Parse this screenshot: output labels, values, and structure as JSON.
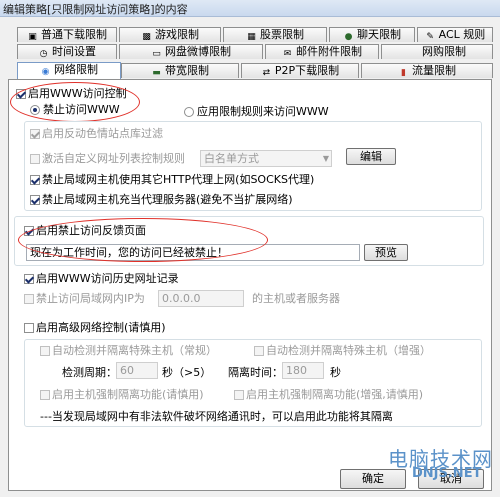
{
  "window": {
    "title": "编辑策略[只限制网址访问策略]的内容"
  },
  "tabs": {
    "row1": [
      {
        "label": "普通下载限制",
        "icon": "download-icon"
      },
      {
        "label": "游戏限制",
        "icon": "game-icon"
      },
      {
        "label": "股票限制",
        "icon": "stock-icon"
      },
      {
        "label": "聊天限制",
        "icon": "chat-icon"
      },
      {
        "label": "ACL 规则",
        "icon": "acl-icon"
      }
    ],
    "row2": [
      {
        "label": "时间设置",
        "icon": "clock-icon"
      },
      {
        "label": "网盘微博限制",
        "icon": "cloud-icon"
      },
      {
        "label": "邮件附件限制",
        "icon": "mail-icon"
      },
      {
        "label": "网购限制",
        "icon": "shop-icon"
      }
    ],
    "row3": [
      {
        "label": "网络限制",
        "icon": "network-icon"
      },
      {
        "label": "带宽限制",
        "icon": "bandwidth-icon"
      },
      {
        "label": "P2P下载限制",
        "icon": "p2p-icon"
      },
      {
        "label": "流量限制",
        "icon": "traffic-icon"
      }
    ]
  },
  "www": {
    "enable_label": "启用WWW访问控制",
    "enable_checked": true,
    "radio_block": "禁止访问WWW",
    "radio_rules": "应用限制规则来访问WWW",
    "porn_filter": "启用反动色情站点库过滤",
    "custom_list": "激活自定义网址列表控制规则",
    "whitelist_mode": "白名单方式",
    "edit_button": "编辑",
    "block_proxy": "禁止局域网主机使用其它HTTP代理上网(如SOCKS代理)",
    "block_proxy_server": "禁止局域网主机充当代理服务器(避免不当扩展网络)"
  },
  "feedback": {
    "enable_label": "启用禁止访问反馈页面",
    "message": "现在为工作时间，您的访问已经被禁止！",
    "preview_button": "预览"
  },
  "history": {
    "enable_label": "启用WWW访问历史网址记录",
    "block_ip_label": "禁止访问局域网内IP为",
    "ip_value": "0.0.0.0",
    "ip_suffix": "的主机或者服务器"
  },
  "advanced": {
    "enable_label": "启用高级网络控制(请慎用)",
    "auto_detect_normal": "自动检测并隔离特殊主机（常规）",
    "auto_detect_enhanced": "自动检测并隔离特殊主机（增强）",
    "period_label": "检测周期：",
    "period_value": "60",
    "period_unit": "秒（>5）",
    "isolation_label": "隔离时间：",
    "isolation_value": "180",
    "isolation_unit": "秒",
    "force_isolate": "启用主机强制隔离功能(请慎用)",
    "force_isolate_enhanced": "启用主机强制隔离功能(增强,请慎用)",
    "note": "---当发现局域网中有非法软件破坏网络通讯时，可以启用此功能将其隔离"
  },
  "footer": {
    "ok_button": "确定",
    "cancel_button": "取消"
  },
  "watermark": {
    "line1": "电脑技术网",
    "line2": "DNJS.NET"
  },
  "colors": {
    "highlight_ellipse": "#e0312a",
    "watermark": "#5b92c9"
  }
}
